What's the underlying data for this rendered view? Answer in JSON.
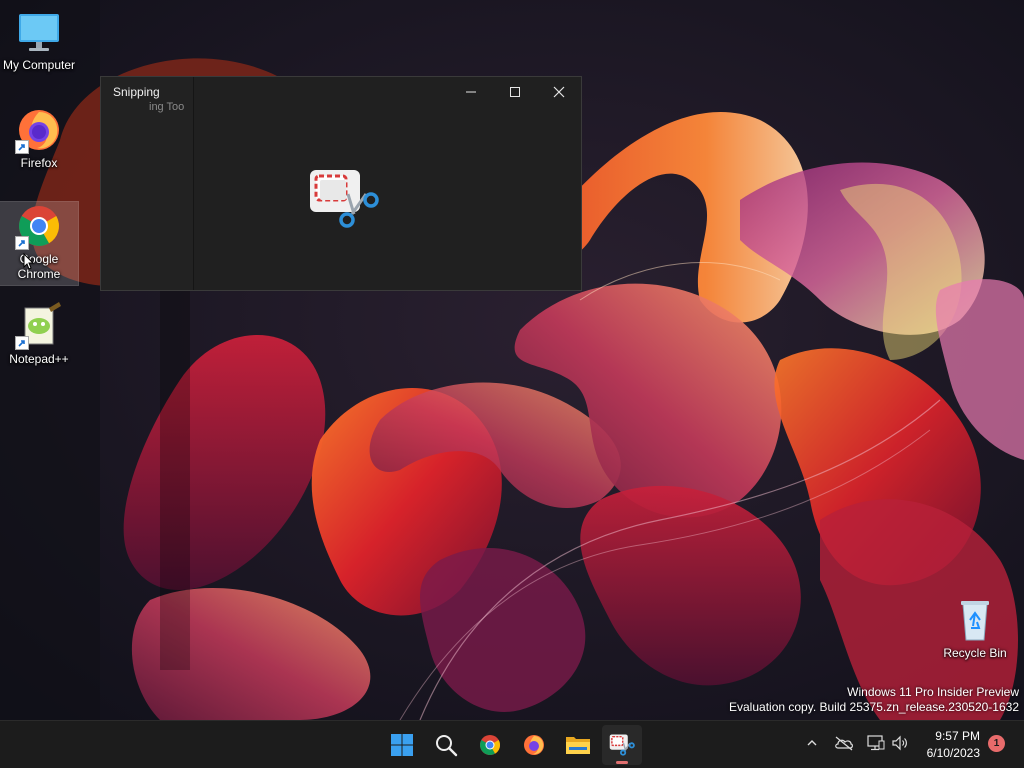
{
  "desktop": {
    "icons": [
      {
        "label": "My Computer",
        "icon": "monitor-icon"
      },
      {
        "label": "Firefox",
        "icon": "firefox-icon"
      },
      {
        "label": "Google Chrome",
        "icon": "chrome-icon"
      },
      {
        "label": "Notepad++",
        "icon": "notepadpp-icon"
      },
      {
        "label": "Recycle Bin",
        "icon": "recycle-bin-icon"
      }
    ],
    "watermark": {
      "line1": "Windows 11 Pro Insider Preview",
      "line2": "Evaluation copy. Build 25375.zn_release.230520-1632"
    }
  },
  "snipping_window": {
    "title": "Snipping",
    "ghost_title": "ing Too",
    "buttons": {
      "minimize": "minimize-icon",
      "maximize": "maximize-icon",
      "close": "close-icon"
    },
    "logo": "snipping-tool-icon"
  },
  "taskbar": {
    "apps": [
      "start-icon",
      "search-icon",
      "chrome-icon",
      "firefox-icon",
      "file-explorer-icon",
      "snipping-tool-icon"
    ],
    "active_app": "snipping-tool-icon",
    "tray": [
      "chevron-up-icon",
      "onedrive-offline-icon",
      "network-icon",
      "volume-icon"
    ],
    "clock": {
      "time": "9:57 PM",
      "date": "6/10/2023"
    },
    "notifications": "1"
  },
  "colors": {
    "taskbar_bg": "#1c1c1c",
    "window_bg": "#202020",
    "accent": "#0078d4",
    "badge": "#e86b6b"
  }
}
